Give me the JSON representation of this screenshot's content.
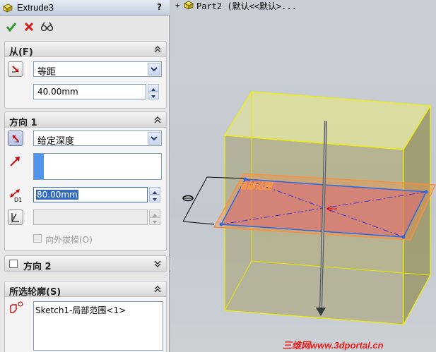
{
  "panel": {
    "title": "Extrude3",
    "help": "?",
    "from": {
      "header": "从(F)",
      "condition": "等距",
      "offset": "40.00mm"
    },
    "direction1": {
      "header": "方向 1",
      "end_condition": "给定深度",
      "depth": "80.00mm",
      "draft_outward": "向外拔模(O)"
    },
    "direction2": {
      "header": "方向 2"
    },
    "contours": {
      "header": "所选轮廓(S)",
      "items": [
        "Sketch1-局部范围<1>"
      ]
    }
  },
  "tree": {
    "expand": "+",
    "label": "Part2  (默认<<默认>..."
  },
  "graphics": {
    "sketch_label": "局部范围"
  },
  "watermark": "三维网www.3dportal.cn",
  "colors": {
    "accept": "#2e9a2e",
    "cancel": "#d21b1b",
    "box_edge": "#f0f000",
    "plane": "#ff8c3a"
  }
}
